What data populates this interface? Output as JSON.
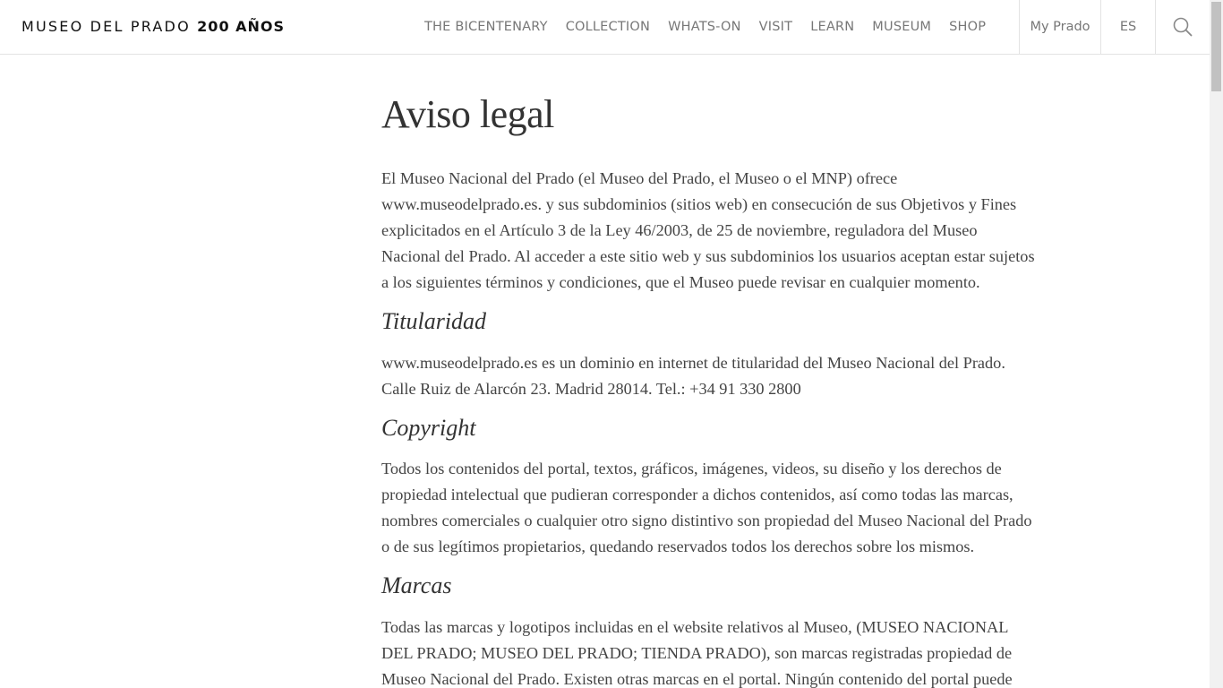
{
  "header": {
    "logo_text": "MUSEO DEL PRADO",
    "logo_years": "200 AÑOS",
    "nav": [
      "THE BICENTENARY",
      "COLLECTION",
      "WHATS-ON",
      "VISIT",
      "LEARN",
      "MUSEUM",
      "SHOP"
    ],
    "my_prado": "My Prado",
    "language": "ES"
  },
  "page": {
    "title": "Aviso legal",
    "intro": "El Museo Nacional del Prado (el Museo del Prado, el Museo o el MNP) ofrece www.museodelprado.es. y sus subdominios (sitios web) en consecución de sus Objetivos y Fines explicitados en el Artículo 3 de la Ley 46/2003, de 25 de noviembre, reguladora del Museo Nacional del Prado. Al acceder a este sitio web y sus subdominios los usuarios aceptan estar sujetos a los siguientes términos y condiciones, que el Museo puede revisar en cualquier momento.",
    "sections": [
      {
        "heading": "Titularidad",
        "text": "www.museodelprado.es es un dominio en internet de titularidad del Museo Nacional del Prado. Calle Ruiz de Alarcón 23. Madrid 28014. Tel.: +34 91 330 2800"
      },
      {
        "heading": "Copyright",
        "text": "Todos los contenidos del portal, textos, gráficos, imágenes, videos, su diseño y los derechos de propiedad intelectual que pudieran corresponder a dichos contenidos, así como todas las marcas, nombres comerciales o cualquier otro signo distintivo son propiedad del Museo Nacional del Prado o de sus legítimos propietarios, quedando reservados todos los derechos sobre los mismos."
      },
      {
        "heading": "Marcas",
        "text": "Todas las marcas y logotipos incluidas en el website relativos al Museo, (MUSEO NACIONAL DEL PRADO; MUSEO DEL PRADO; TIENDA PRADO), son marcas registradas propiedad de Museo Nacional del Prado. Existen otras marcas en el portal. Ningún contenido del portal puede"
      }
    ]
  }
}
